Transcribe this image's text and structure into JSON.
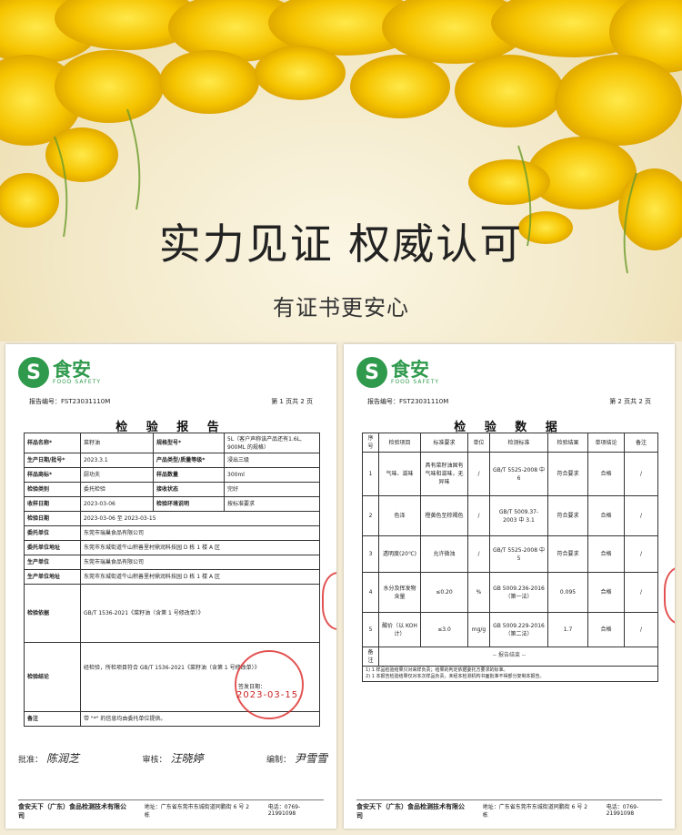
{
  "hero": {
    "title": "实力见证 权威认可",
    "subtitle": "有证书更安心"
  },
  "logo": {
    "mark": "S",
    "cn": "食安",
    "en": "FOOD SAFETY"
  },
  "report": {
    "number": "报告编号：FST23031110M",
    "page1": "第 1 页共 2 页",
    "page2": "第 2 页共 2 页",
    "title1": "检 验 报 告",
    "title2": "检 验 数 据",
    "fields": {
      "sample_name_l": "样品名称*",
      "sample_name_v": "菜籽油",
      "spec_l": "规格型号*",
      "spec_v": "5L（客户声称该产品还有1.6L, 900ML 的规格）",
      "date_l": "生产日期/批号*",
      "date_v": "2023.3.1",
      "grade_l": "产品类型/质量等级*",
      "grade_v": "浸出三级",
      "brand_l": "样品商标*",
      "brand_v": "厨功夫",
      "qty_l": "样品数量",
      "qty_v": "300ml",
      "type_l": "检验类别",
      "type_v": "委托检验",
      "state_l": "接收状态",
      "state_v": "完好",
      "recv_l": "收样日期",
      "recv_v": "2023-03-06",
      "env_l": "检验环境说明",
      "env_v": "按标准要求",
      "testdate_l": "检验日期",
      "testdate_v": "2023-03-06 至 2023-03-15",
      "client_l": "委托单位",
      "client_v": "东莞市瑞巢食品有限公司",
      "client_addr_l": "委托单位地址",
      "client_addr_v": "东莞市东城街道牛山积善里村鼎润科技园 D 栋 1 楼 A 区",
      "maker_l": "生产单位",
      "maker_v": "东莞市瑞巢食品有限公司",
      "maker_addr_l": "生产单位地址",
      "maker_addr_v": "东莞市东城街道牛山积善里村鼎润科技园 D 栋 1 楼 A 区",
      "basis_l": "检验依据",
      "basis_v": "GB/T 1536-2021《菜籽油（含第 1 号修改单）》",
      "concl_l": "检验结论",
      "concl_v": "经检验，所检项目符合 GB/T 1536-2021《菜籽油（含第 1 号修改单）》",
      "sign_date": "签发日期：",
      "remark_l": "备注",
      "remark_v": "带 \"*\" 的信息均由委托单位提供。"
    },
    "stamp_date": "2023-03-15",
    "signatures": {
      "approve": "批准：",
      "approve_sig": "陈润芝",
      "review": "审核：",
      "review_sig": "汪晓婷",
      "compile": "编制：",
      "compile_sig": "尹雪雪"
    },
    "footer_name": "食安天下（广东）食品检测技术有限公司",
    "footer_addr": "地址：广东省东莞市东城街道同鹏街 6 号 2 栋",
    "footer_tel": "电话：0769-21991098",
    "data_headers": [
      "序号",
      "检验项目",
      "标准要求",
      "单位",
      "检测标准",
      "检验结果",
      "单项结论",
      "备注"
    ],
    "data_rows": [
      [
        "1",
        "气味、滋味",
        "具有菜籽油固有气味和滋味，无异味",
        "/",
        "GB/T 5525-2008 中 6",
        "符合要求",
        "合格",
        "/"
      ],
      [
        "2",
        "色泽",
        "橙黄色至棕褐色",
        "/",
        "GB/T 5009.37-2003 中 3.1",
        "符合要求",
        "合格",
        "/"
      ],
      [
        "3",
        "透明度(20℃)",
        "允许微浊",
        "/",
        "GB/T 5525-2008 中 5",
        "符合要求",
        "合格",
        "/"
      ],
      [
        "4",
        "水分及挥发物含量",
        "≤0.20",
        "%",
        "GB 5009.236-2016（第一法）",
        "0.095",
        "合格",
        "/"
      ],
      [
        "5",
        "酸价（以 KOH 计）",
        "≤3.0",
        "mg/g",
        "GB 5009.229-2016（第二法）",
        "1.7",
        "合格",
        "/"
      ]
    ],
    "data_remark_l": "备注",
    "data_note1": "1) 1 样品检验结果只对来样负责；结果的判定依据委托方要求的标准。",
    "data_note2": "2) 1 本报告检验结果仅对本次样品负责，未经本检测机构书面批准不得部分复制本报告。",
    "end": "-- 报告结束 --"
  }
}
